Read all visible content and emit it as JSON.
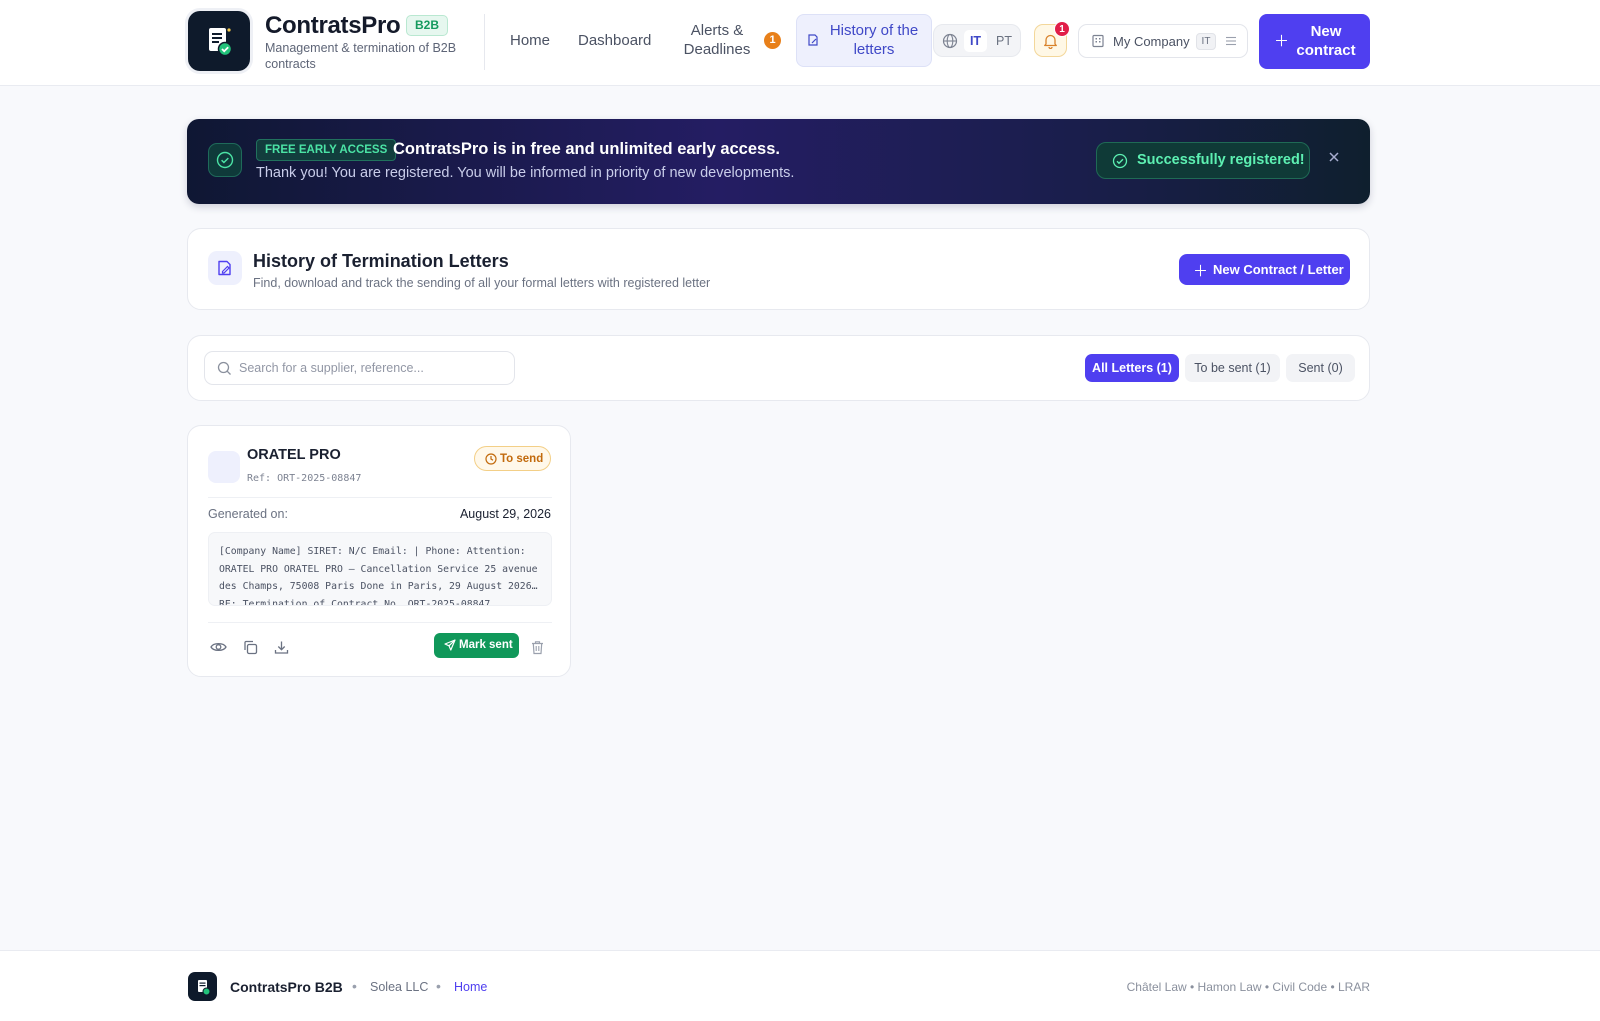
{
  "header": {
    "brand": "ContratsPro",
    "badge": "B2B",
    "tagline": "Management & termination of B2B contracts",
    "nav": {
      "home": "Home",
      "dashboard": "Dashboard",
      "alerts": "Alerts & Deadlines",
      "alerts_count": "1",
      "history": "History of the letters"
    },
    "languages": {
      "active": "IT",
      "other": "PT"
    },
    "notifications_count": "1",
    "company": {
      "name": "My Company",
      "code": "IT"
    },
    "new_contract": "New contract"
  },
  "banner": {
    "tag": "FREE EARLY ACCESS",
    "headline": "ContratsPro is in free and unlimited early access.",
    "subtitle": "Thank you! You are registered. You will be informed in priority of new developments.",
    "status": "Successfully registered!"
  },
  "page": {
    "title": "History of Termination Letters",
    "description": "Find, download and track the sending of all your formal letters with registered letter",
    "new_button": "New Contract / Letter"
  },
  "filters": {
    "search_placeholder": "Search for a supplier, reference...",
    "tabs": {
      "all": "All Letters (1)",
      "to_be_sent": "To be sent (1)",
      "sent": "Sent (0)"
    }
  },
  "letters": [
    {
      "supplier": "ORATEL PRO",
      "ref": "Ref: ORT-2025-08847",
      "status": "To send",
      "generated_label": "Generated on:",
      "generated_date": "August 29, 2026",
      "preview": "[Company Name] SIRET: N/C Email: | Phone: Attention: ORATEL PRO ORATEL PRO – Cancellation Service 25 avenue des Champs, 75008 Paris Done in Paris, 29 August 2026… RE: Termination of Contract No. ORT-2025-08847",
      "mark_sent": "Mark sent"
    }
  ],
  "footer": {
    "brand": "ContratsPro B2B",
    "company": "Solea LLC",
    "home": "Home",
    "legal": "Châtel Law • Hamon Law • Civil Code • LRAR"
  },
  "colors": {
    "primary": "#4f3ff0",
    "success": "#10985a",
    "warning": "#c26a0c",
    "alert": "#e8801a",
    "danger": "#e11d48"
  },
  "icons": {
    "logo": "document-check-icon",
    "history": "document-edit-icon",
    "language": "globe-icon",
    "notifications": "bell-icon",
    "company": "building-icon",
    "company_menu": "sliders-icon",
    "add": "plus-icon",
    "banner": "check-circle-icon",
    "close": "close-icon",
    "search": "search-icon",
    "status": "clock-icon",
    "actions": [
      "eye-icon",
      "copy-icon",
      "download-icon",
      "send-icon",
      "trash-icon"
    ]
  }
}
